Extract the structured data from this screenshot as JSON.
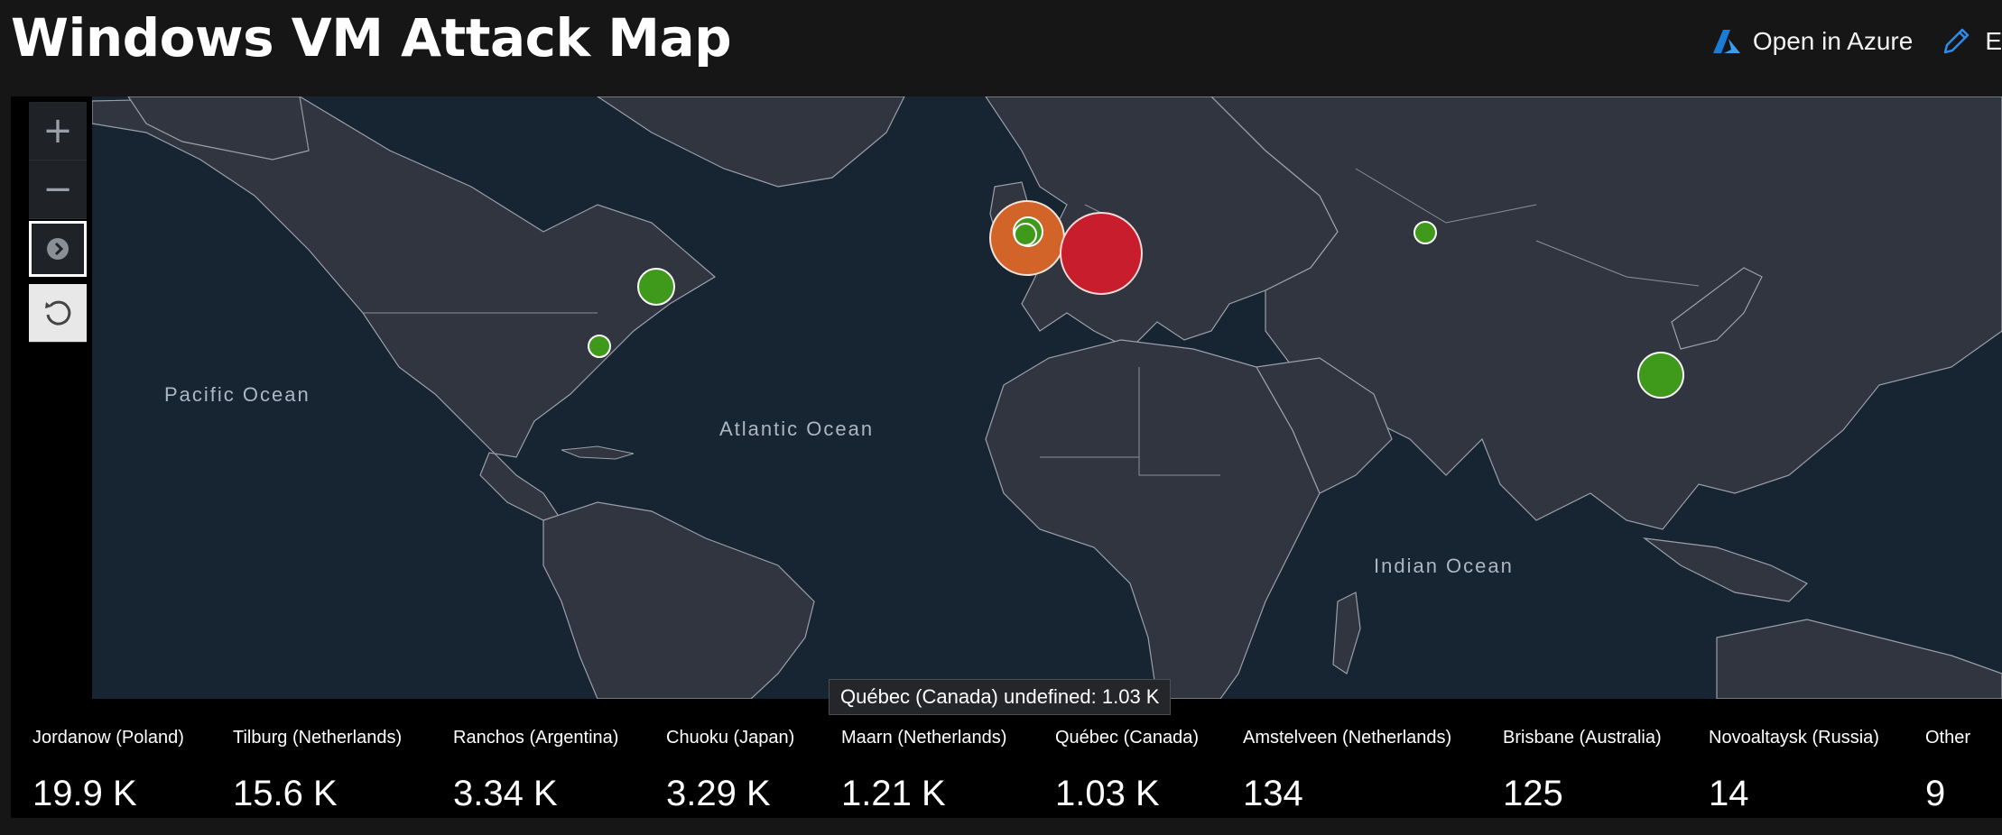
{
  "page": {
    "title": "Windows VM Attack Map"
  },
  "header": {
    "open_azure_label": "Open in Azure",
    "edit_label": "E",
    "azure_icon": "azure-logo-icon",
    "edit_icon": "pencil-icon",
    "accent_color": "#1a7cd6"
  },
  "map": {
    "oceans": {
      "pacific": "Pacific Ocean",
      "atlantic": "Atlantic Ocean",
      "indian": "Indian Ocean"
    },
    "controls": {
      "zoom_in": "+",
      "zoom_out": "−",
      "style_picker_icon": "map-style-icon",
      "reset_icon": "reset-rotation-icon"
    },
    "colors": {
      "high": "#c81d2d",
      "medium": "#d2642a",
      "low": "#3f9a1c",
      "land": "#31353f",
      "water": "#172432"
    },
    "tooltip": "Québec (Canada) undefined: 1.03 K"
  },
  "legend": [
    {
      "name": "Jordanow (Poland)",
      "value": "19.9 K"
    },
    {
      "name": "Tilburg (Netherlands)",
      "value": "15.6 K"
    },
    {
      "name": "Ranchos (Argentina)",
      "value": "3.34 K"
    },
    {
      "name": "Chuoku (Japan)",
      "value": "3.29 K"
    },
    {
      "name": "Maarn (Netherlands)",
      "value": "1.21 K"
    },
    {
      "name": "Québec (Canada)",
      "value": "1.03 K"
    },
    {
      "name": "Amstelveen (Netherlands)",
      "value": "134"
    },
    {
      "name": "Brisbane (Australia)",
      "value": "125"
    },
    {
      "name": "Novoaltaysk (Russia)",
      "value": "14"
    },
    {
      "name": "Other",
      "value": "9"
    }
  ]
}
